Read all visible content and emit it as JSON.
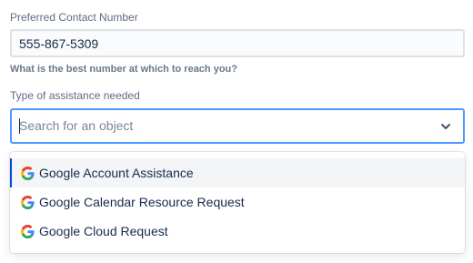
{
  "form": {
    "phone_label": "Preferred Contact Number",
    "phone_value": "555-867-5309",
    "phone_help": "What is the best number at which to reach you?",
    "assistance_label": "Type of assistance needed",
    "assistance_placeholder": "Search for an object"
  },
  "dropdown": {
    "options": [
      {
        "label": "Google Account Assistance",
        "icon": "google-icon",
        "highlighted": true
      },
      {
        "label": "Google Calendar Resource Request",
        "icon": "google-icon",
        "highlighted": false
      },
      {
        "label": "Google Cloud Request",
        "icon": "google-icon",
        "highlighted": false
      }
    ]
  },
  "colors": {
    "focus_border": "#4c9aff",
    "active_option_bar": "#0052cc",
    "label": "#5e6c84"
  }
}
